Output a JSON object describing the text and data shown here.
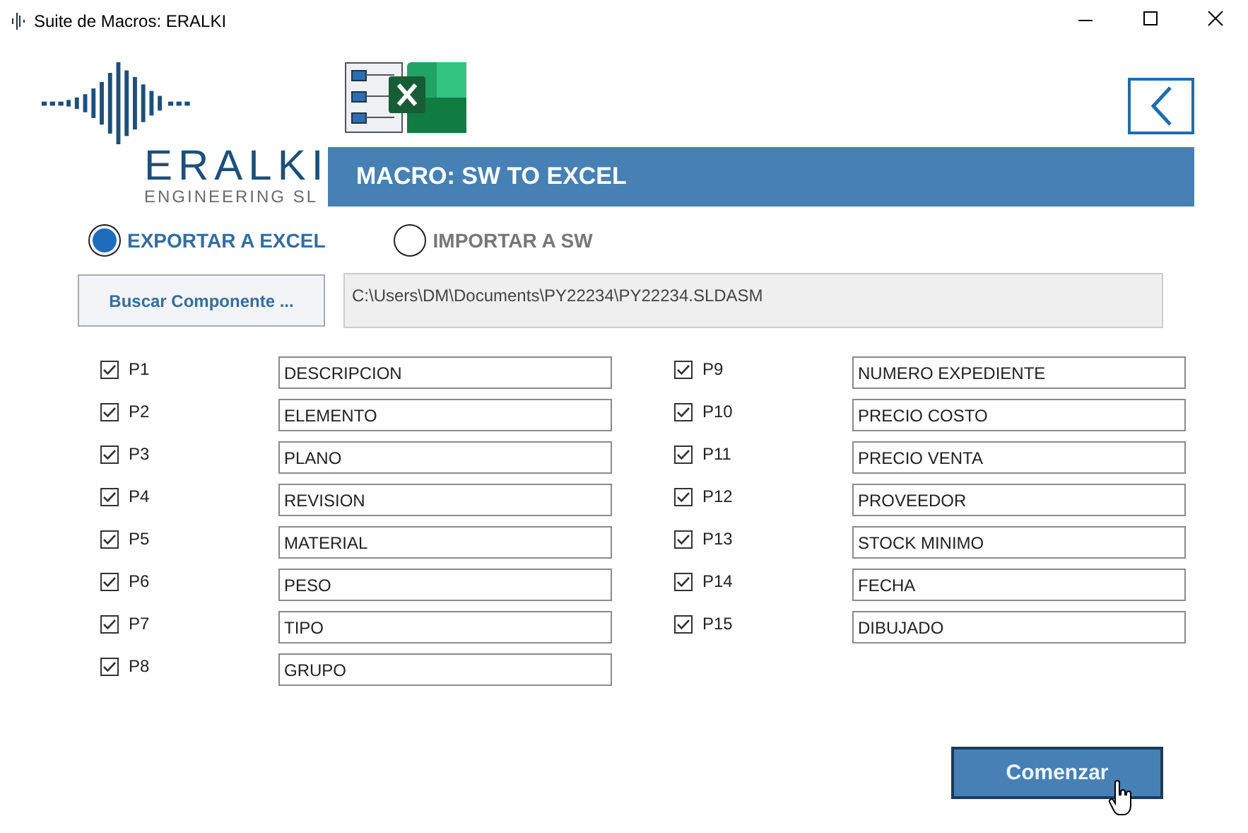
{
  "window": {
    "title": "Suite de Macros: ERALKI"
  },
  "logo": {
    "name": "ERALKI",
    "subtitle": "ENGINEERING SL"
  },
  "header": {
    "title": "MACRO: SW TO EXCEL"
  },
  "modes": [
    {
      "label": "EXPORTAR A EXCEL",
      "selected": true
    },
    {
      "label": "IMPORTAR A SW",
      "selected": false
    }
  ],
  "browse_button": "Buscar Componente ...",
  "path": {
    "value": "C:\\Users\\DM\\Documents\\PY22234\\PY22234.SLDASM"
  },
  "columns": [
    [
      {
        "label": "P1",
        "checked": true,
        "value": "DESCRIPCION"
      },
      {
        "label": "P2",
        "checked": true,
        "value": "ELEMENTO"
      },
      {
        "label": "P3",
        "checked": true,
        "value": "PLANO"
      },
      {
        "label": "P4",
        "checked": true,
        "value": "REVISION"
      },
      {
        "label": "P5",
        "checked": true,
        "value": "MATERIAL"
      },
      {
        "label": "P6",
        "checked": true,
        "value": "PESO"
      },
      {
        "label": "P7",
        "checked": true,
        "value": "TIPO"
      },
      {
        "label": "P8",
        "checked": true,
        "value": "GRUPO"
      }
    ],
    [
      {
        "label": "P9",
        "checked": true,
        "value": "NUMERO EXPEDIENTE"
      },
      {
        "label": "P10",
        "checked": true,
        "value": "PRECIO COSTO"
      },
      {
        "label": "P11",
        "checked": true,
        "value": "PRECIO VENTA"
      },
      {
        "label": "P12",
        "checked": true,
        "value": "PROVEEDOR"
      },
      {
        "label": "P13",
        "checked": true,
        "value": "STOCK MINIMO"
      },
      {
        "label": "P14",
        "checked": true,
        "value": "FECHA"
      },
      {
        "label": "P15",
        "checked": true,
        "value": "DIBUJADO"
      }
    ]
  ],
  "start_button": "Comenzar"
}
